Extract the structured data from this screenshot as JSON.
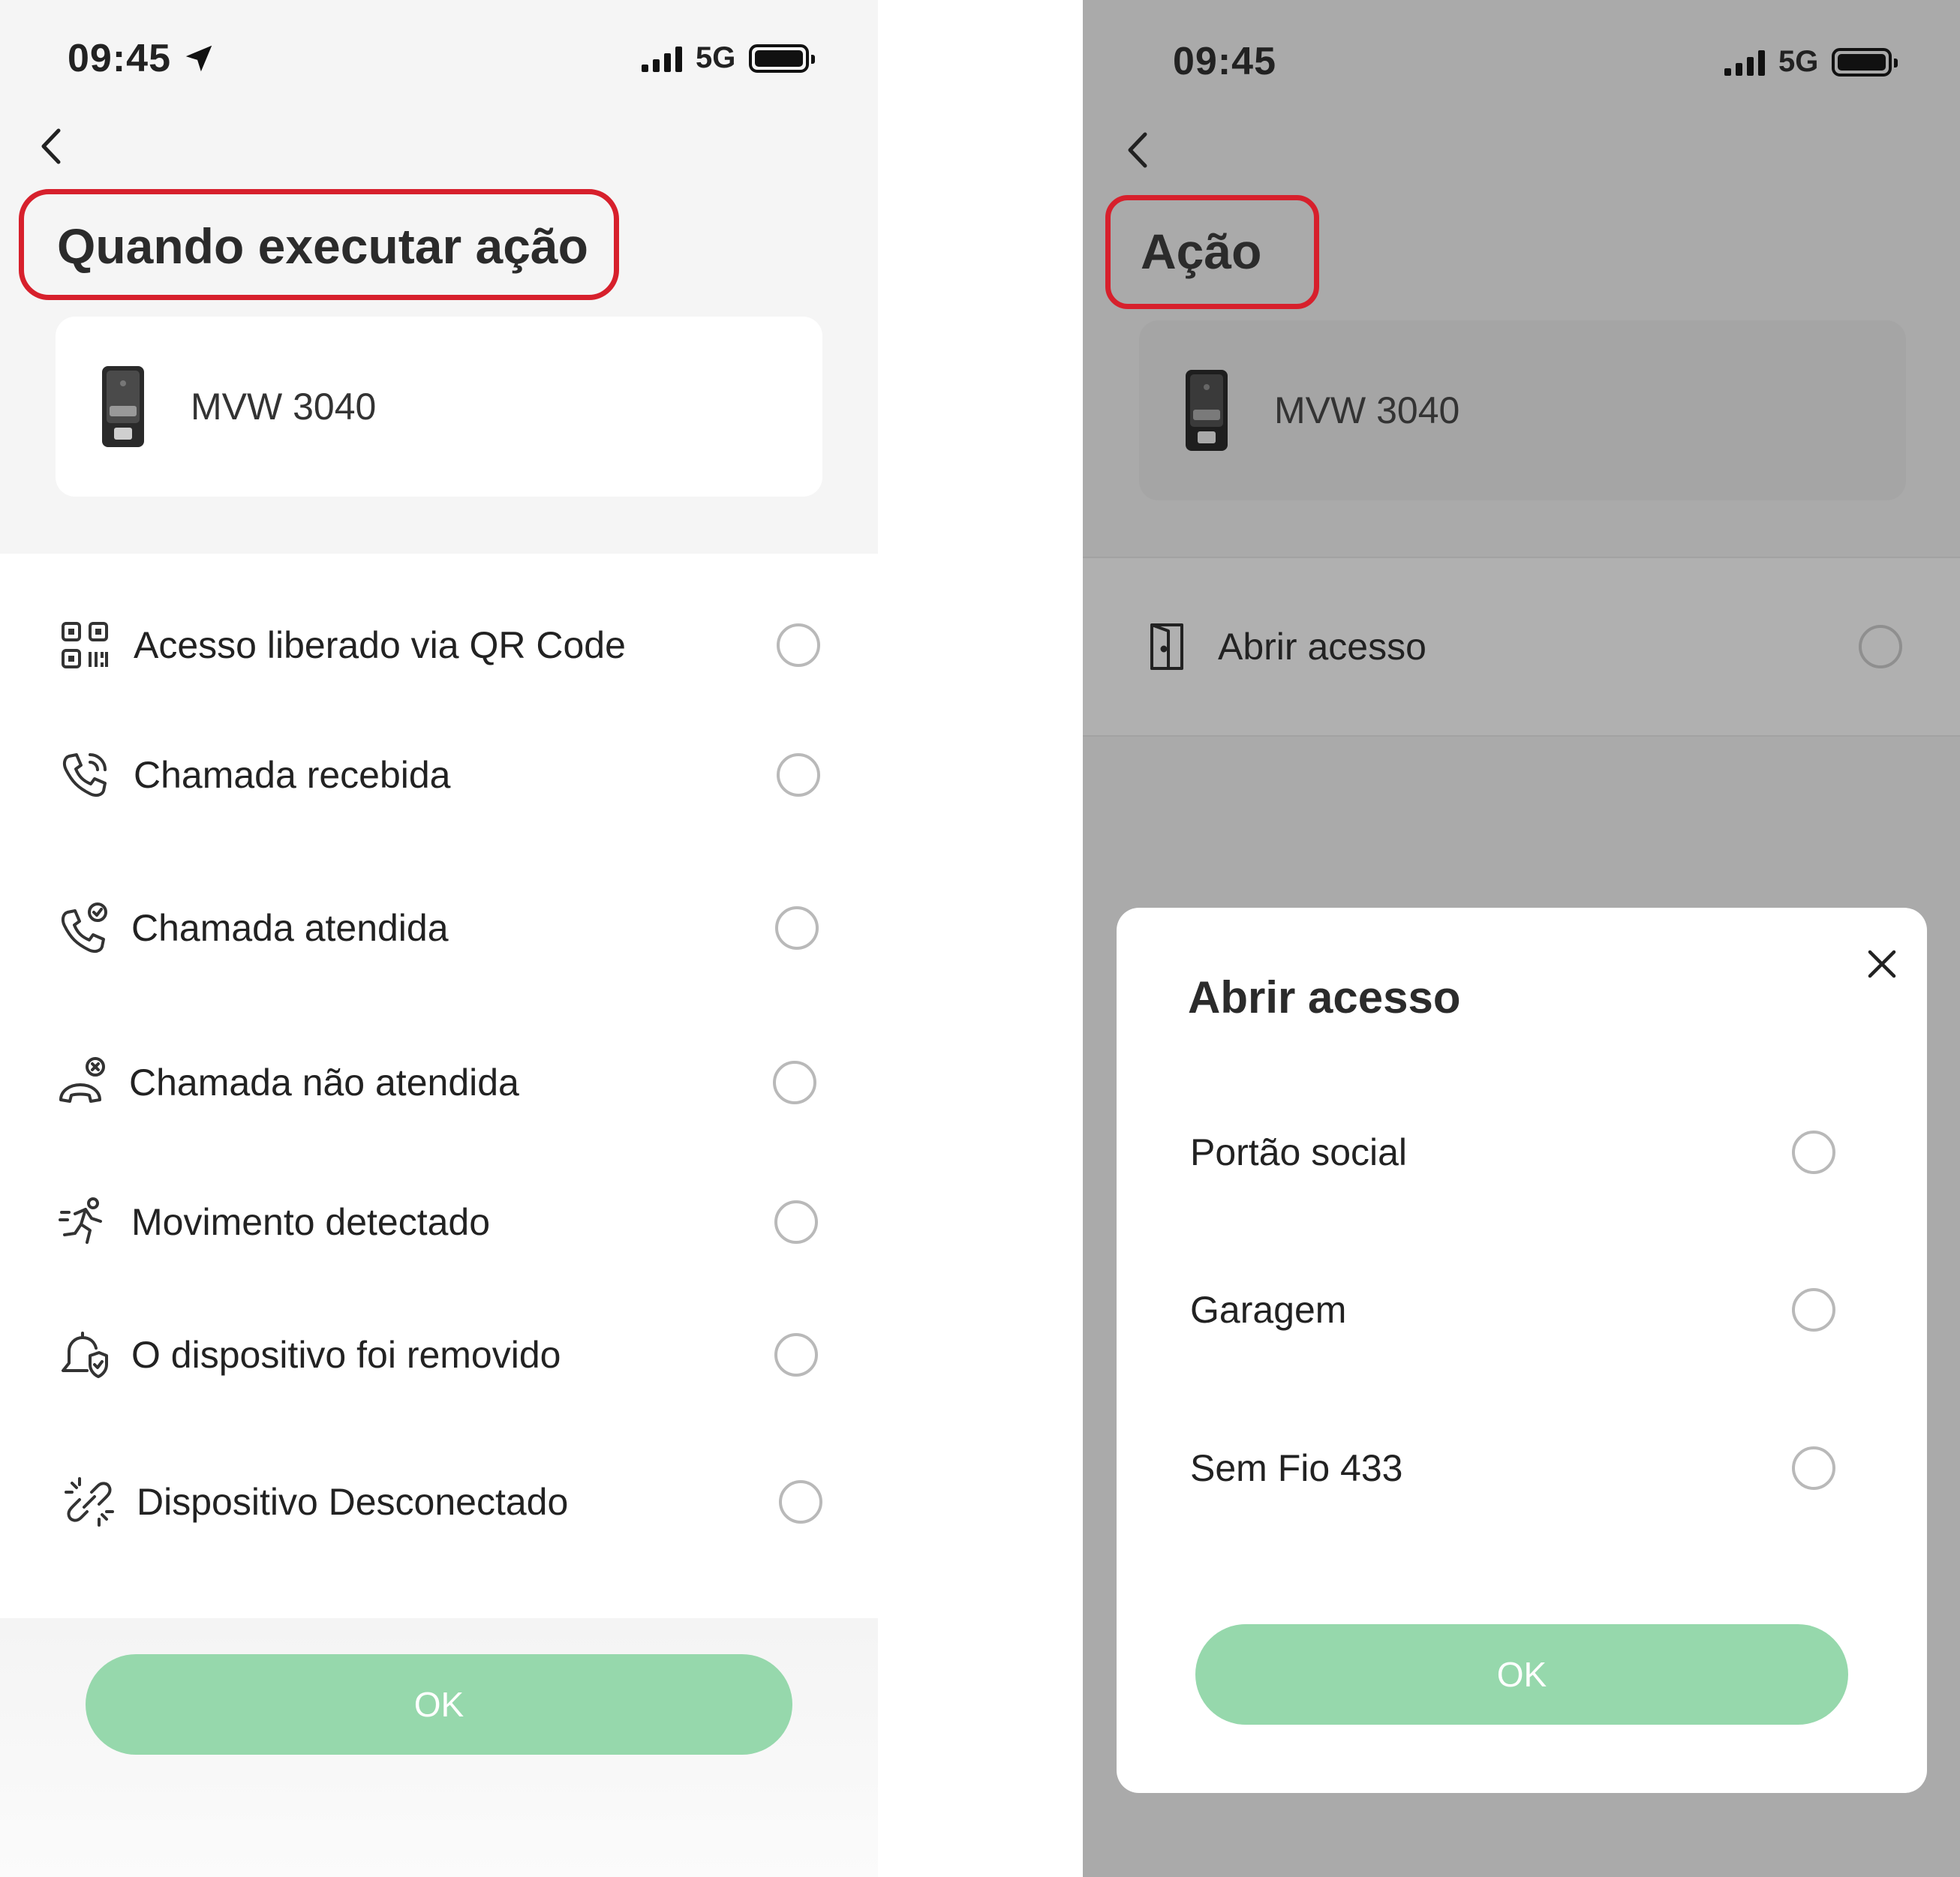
{
  "status_bar": {
    "time": "09:45",
    "network": "5G"
  },
  "left_screen": {
    "title": "Quando executar ação",
    "device": {
      "name": "MVW 3040"
    },
    "triggers": [
      {
        "icon": "qr-code-icon",
        "label": "Acesso liberado via QR Code"
      },
      {
        "icon": "incoming-call-icon",
        "label": "Chamada recebida"
      },
      {
        "icon": "answered-call-icon",
        "label": "Chamada atendida"
      },
      {
        "icon": "missed-call-icon",
        "label": "Chamada não atendida"
      },
      {
        "icon": "motion-icon",
        "label": "Movimento detectado"
      },
      {
        "icon": "device-removed-icon",
        "label": "O dispositivo foi removido"
      },
      {
        "icon": "disconnected-link-icon",
        "label": "Dispositivo Desconectado"
      }
    ],
    "ok_label": "OK"
  },
  "right_screen": {
    "title": "Ação",
    "device": {
      "name": "MVW 3040"
    },
    "actions": [
      {
        "icon": "door-icon",
        "label": "Abrir acesso"
      }
    ],
    "modal": {
      "title": "Abrir acesso",
      "options": [
        {
          "label": "Portão social"
        },
        {
          "label": "Garagem"
        },
        {
          "label": "Sem Fio 433"
        }
      ],
      "ok_label": "OK"
    }
  },
  "colors": {
    "highlight": "#d7202c",
    "ok_button": "#96d8ac",
    "dim_overlay": "#aaaaaa"
  }
}
